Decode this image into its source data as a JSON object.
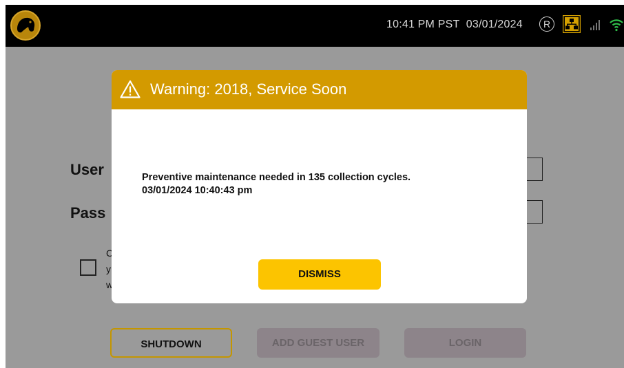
{
  "topbar": {
    "time": "10:41 PM PST",
    "date": "03/01/2024",
    "registered_symbol": "R",
    "icons": [
      "dog-logo-icon",
      "registered-icon",
      "network-icon",
      "signal-bars-icon",
      "wifi-icon"
    ]
  },
  "form": {
    "username_label": "User",
    "password_label": "Pass",
    "checkbox_text_lines": [
      "C",
      "y",
      "w"
    ]
  },
  "buttons": {
    "shutdown": "SHUTDOWN",
    "add_guest": "ADD GUEST USER",
    "login": "LOGIN"
  },
  "modal": {
    "title": "Warning:  2018,  Service Soon",
    "message_line1": "Preventive maintenance needed in 135 collection cycles.",
    "message_line2": "03/01/2024 10:40:43 pm",
    "dismiss_label": "DISMISS"
  },
  "colors": {
    "header_bar": "#000000",
    "overlay": "#9a9a9a",
    "warning_header": "#d39a00",
    "dismiss_button": "#fcc400",
    "accent_border": "#c49600"
  }
}
